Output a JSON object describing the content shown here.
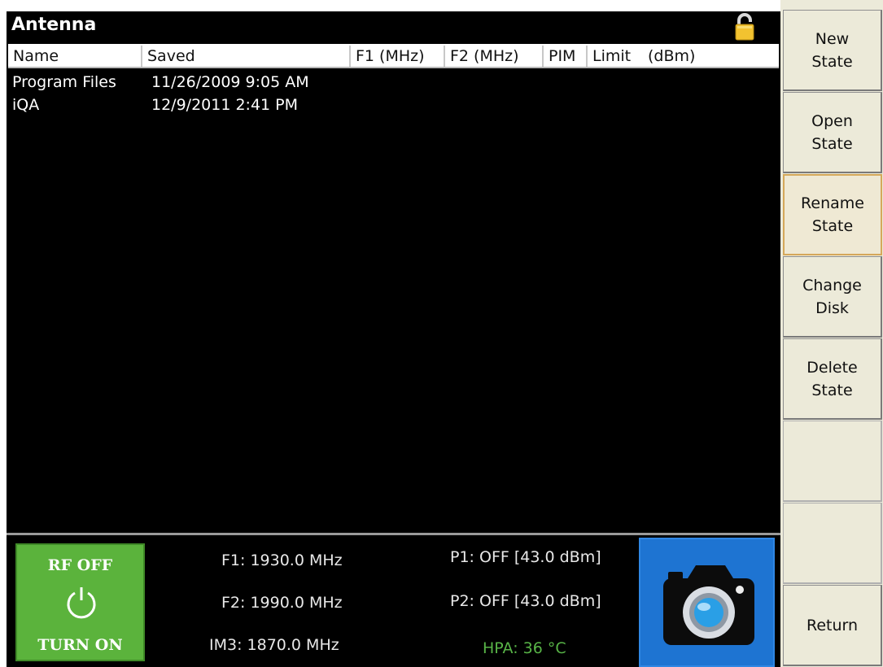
{
  "window": {
    "title": "Antenna"
  },
  "table": {
    "columns": [
      "Name",
      "Saved",
      "F1 (MHz)",
      "F2 (MHz)",
      "PIM",
      "Limit",
      "(dBm)"
    ],
    "rows": [
      {
        "name": "Program Files",
        "saved": "11/26/2009  9:05 AM"
      },
      {
        "name": "iQA",
        "saved": "12/9/2011  2:41 PM"
      }
    ]
  },
  "status": {
    "rf_state": "RF OFF",
    "rf_action": "TURN ON",
    "f1": "F1: 1930.0 MHz",
    "f2": "F2: 1990.0 MHz",
    "im3": "IM3: 1870.0 MHz",
    "p1": "P1: OFF [43.0 dBm]",
    "p2": "P2: OFF [43.0 dBm]",
    "hpa": "HPA: 36 °C"
  },
  "softkeys": {
    "new_state": "New\nState",
    "open_state": "Open\nState",
    "rename_state": "Rename\nState",
    "change_disk": "Change\nDisk",
    "delete_state": "Delete\nState",
    "return": "Return"
  },
  "icons": {
    "lock": "lock-icon",
    "power": "power-icon",
    "camera": "camera-icon"
  },
  "colors": {
    "screen_bg": "#000000",
    "rf_button": "#5bb33c",
    "camera_button": "#1e74d2",
    "hpa_text": "#58b447",
    "softkey_bg": "#ecead9",
    "highlight_border": "#d5a85a"
  }
}
